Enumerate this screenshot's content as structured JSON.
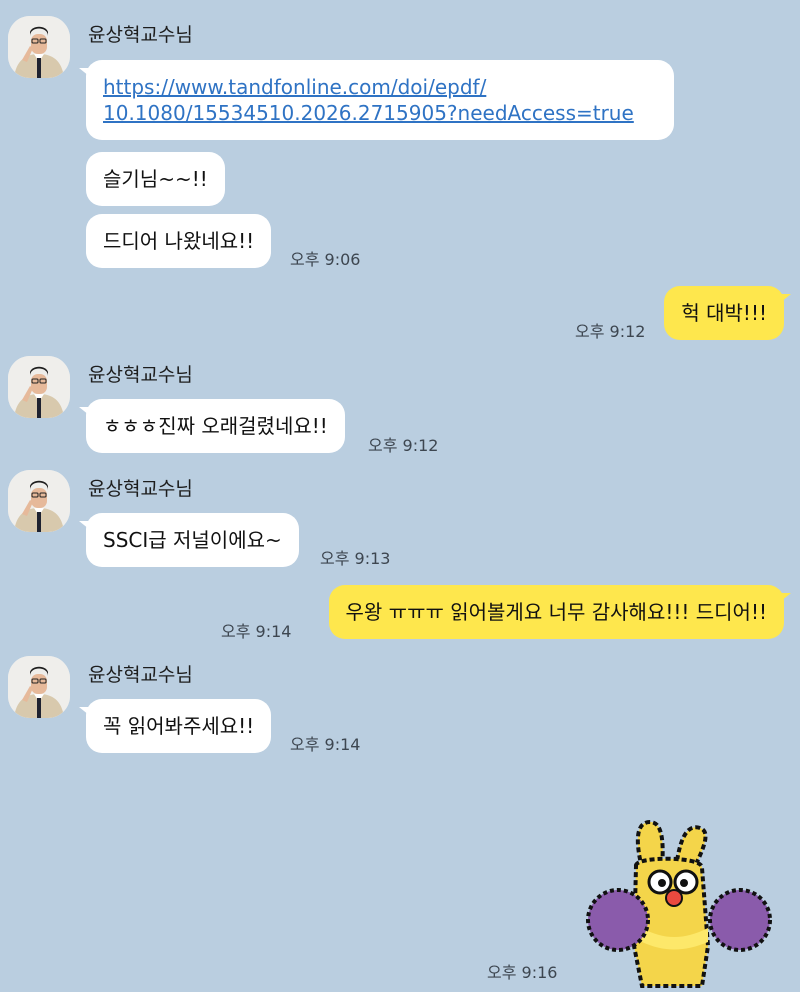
{
  "sender": "윤상혁교수님",
  "messages": {
    "link_line1": "https://www.tandfonline.com/doi/epdf/",
    "link_line2": "10.1080/15534510.2026.2715905?needAccess=true",
    "m2": "슬기님~~!!",
    "m3": "드디어 나왔네요!!",
    "m4": "헉 대박!!!",
    "m5": "ㅎㅎㅎ진짜 오래걸렸네요!!",
    "m6": "SSCI급 저널이에요~",
    "m7": "우왕 ㅠㅠㅠ 읽어볼게요 너무 감사해요!!! 드디어!!",
    "m8": "꼭 읽어봐주세요!!"
  },
  "times": {
    "t1": "오후 9:06",
    "t2": "오후 9:12",
    "t3": "오후 9:12",
    "t4": "오후 9:13",
    "t5": "오후 9:14",
    "t6": "오후 9:14",
    "t7": "오후 9:16"
  },
  "sticker": "yellow-bunny-cheerleader-sticker",
  "colors": {
    "background": "#bacee0",
    "incoming_bubble": "#ffffff",
    "outgoing_bubble": "#fee74d",
    "link": "#2f73c4"
  }
}
